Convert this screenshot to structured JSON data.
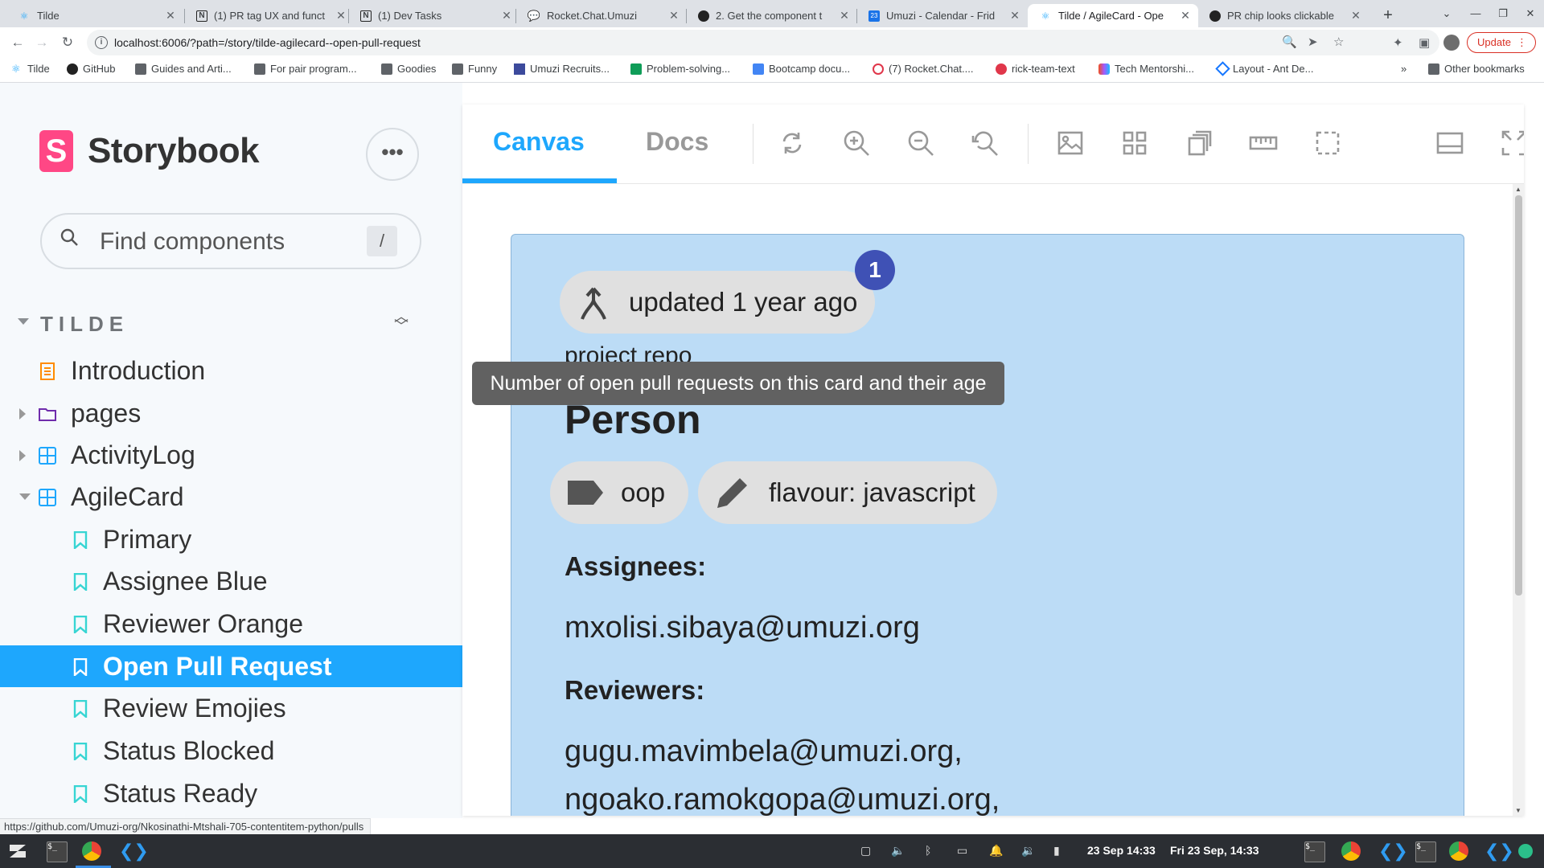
{
  "browser": {
    "tabs": [
      {
        "title": "Tilde",
        "icon": "react-icon"
      },
      {
        "title": "(1) PR tag UX and funct",
        "icon": "notion-icon"
      },
      {
        "title": "(1) Dev Tasks",
        "icon": "notion-icon"
      },
      {
        "title": "Rocket.Chat.Umuzi",
        "icon": "rocketchat-icon"
      },
      {
        "title": "2. Get the component t",
        "icon": "github-icon"
      },
      {
        "title": "Umuzi - Calendar - Frid",
        "icon": "calendar-icon"
      },
      {
        "title": "Tilde / AgileCard - Ope",
        "icon": "react-icon",
        "active": true
      },
      {
        "title": "PR chip looks clickable",
        "icon": "github-icon"
      }
    ],
    "url": "localhost:6006/?path=/story/tilde-agilecard--open-pull-request",
    "update_label": "Update",
    "bookmarks": [
      {
        "label": "Tilde",
        "icon": "react-icon"
      },
      {
        "label": "GitHub",
        "icon": "github-icon"
      },
      {
        "label": "Guides and Arti...",
        "icon": "folder-icon"
      },
      {
        "label": "For pair program...",
        "icon": "folder-icon"
      },
      {
        "label": "Goodies",
        "icon": "folder-icon"
      },
      {
        "label": "Funny",
        "icon": "folder-icon"
      },
      {
        "label": "Umuzi Recruits...",
        "icon": "umuzi-icon"
      },
      {
        "label": "Problem-solving...",
        "icon": "sheets-icon"
      },
      {
        "label": "Bootcamp docu...",
        "icon": "docs-icon"
      },
      {
        "label": "(7) Rocket.Chat....",
        "icon": "rocketchat-icon"
      },
      {
        "label": "rick-team-text",
        "icon": "calendar-icon"
      },
      {
        "label": "Tech Mentorshi...",
        "icon": "figma-icon"
      },
      {
        "label": "Layout - Ant De...",
        "icon": "antd-icon"
      }
    ],
    "bookmarks_overflow": "»",
    "other_bookmarks": "Other bookmarks",
    "status_url": "https://github.com/Umuzi-org/Nkosinathi-Mtshali-705-contentitem-python/pulls"
  },
  "storybook": {
    "brand": "Storybook",
    "search_placeholder": "Find components",
    "search_shortcut": "/",
    "group": "TILDE",
    "tree": [
      {
        "label": "Introduction",
        "kind": "doc"
      },
      {
        "label": "pages",
        "kind": "folder"
      },
      {
        "label": "ActivityLog",
        "kind": "component"
      },
      {
        "label": "AgileCard",
        "kind": "component",
        "expanded": true
      },
      {
        "label": "Primary",
        "kind": "story"
      },
      {
        "label": "Assignee Blue",
        "kind": "story"
      },
      {
        "label": "Reviewer Orange",
        "kind": "story"
      },
      {
        "label": "Open Pull Request",
        "kind": "story",
        "selected": true
      },
      {
        "label": "Review Emojies",
        "kind": "story"
      },
      {
        "label": "Status Blocked",
        "kind": "story"
      },
      {
        "label": "Status Ready",
        "kind": "story"
      }
    ],
    "tabs": {
      "canvas": "Canvas",
      "docs": "Docs"
    }
  },
  "card": {
    "pr_chip_label": "updated 1 year ago",
    "pr_count": "1",
    "project_label": "project repo",
    "title": "Person",
    "tags": [
      {
        "label": "oop",
        "icon": "label-icon"
      },
      {
        "label": "flavour: javascript",
        "icon": "pencil-icon"
      }
    ],
    "assignees_heading": "Assignees:",
    "assignees": "mxolisi.sibaya@umuzi.org",
    "reviewers_heading": "Reviewers:",
    "reviewers": [
      "gugu.mavimbela@umuzi.org,",
      "ngoako.ramokgopa@umuzi.org,"
    ],
    "tooltip": "Number of open pull requests on this card and their age",
    "colors": {
      "card_bg": "#bcdcf6",
      "badge": "#3f51b5",
      "selected": "#1ea7fd"
    }
  },
  "taskbar": {
    "date_short": "23 Sep 14:33",
    "date_long": "Fri 23 Sep, 14:33"
  }
}
